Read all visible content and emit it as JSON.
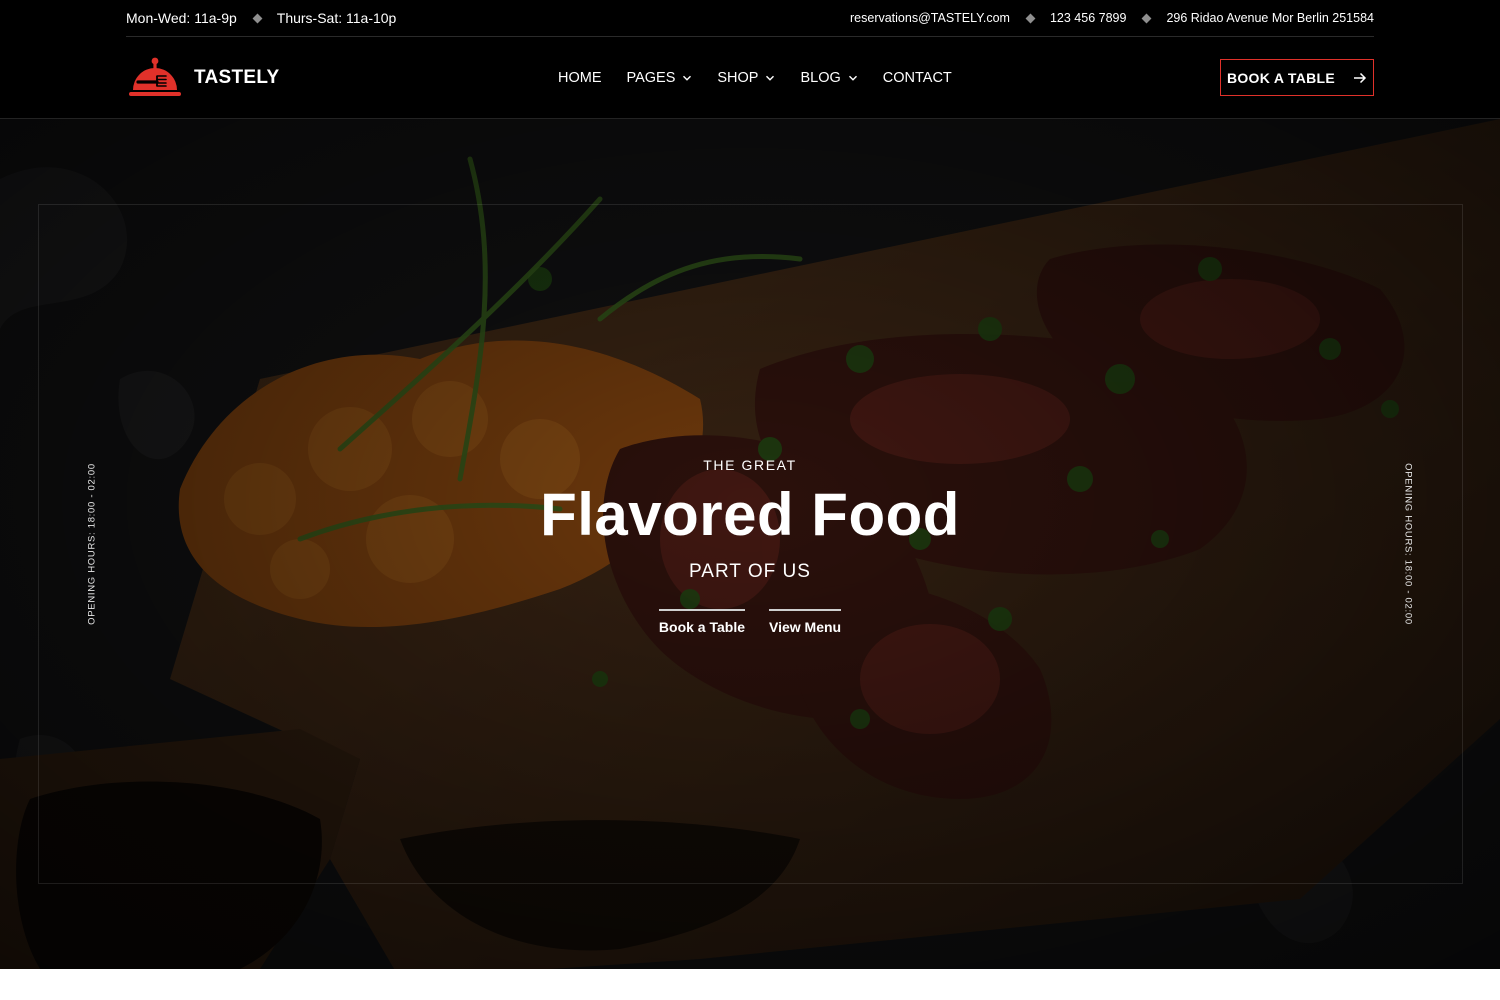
{
  "topbar": {
    "hours": [
      "Mon-Wed: 11a-9p",
      "Thurs-Sat: 11a-10p"
    ],
    "email": "reservations@TASTELY.com",
    "phone": "123 456 7899",
    "address": "296 Ridao Avenue Mor Berlin 251584"
  },
  "header": {
    "brand": "TASTELY",
    "nav": [
      {
        "label": "HOME",
        "has_dropdown": false
      },
      {
        "label": "PAGES",
        "has_dropdown": true
      },
      {
        "label": "SHOP",
        "has_dropdown": true
      },
      {
        "label": "BLOG",
        "has_dropdown": true
      },
      {
        "label": "CONTACT",
        "has_dropdown": false
      }
    ],
    "cta_label": "BOOK A TABLE"
  },
  "hero": {
    "eyebrow": "THE GREAT",
    "title": "Flavored Food",
    "subtitle": "PART OF US",
    "buttons": [
      "Book a Table",
      "View Menu"
    ],
    "side_text": "OPENING HOURS: 18:00 - 02:00"
  },
  "colors": {
    "accent": "#e0312a",
    "background": "#000000",
    "text": "#ffffff"
  },
  "icons": {
    "logo": "cloche-fork-icon",
    "separator": "diamond-icon",
    "dropdown": "chevron-down-icon",
    "cta": "arrow-right-icon"
  }
}
